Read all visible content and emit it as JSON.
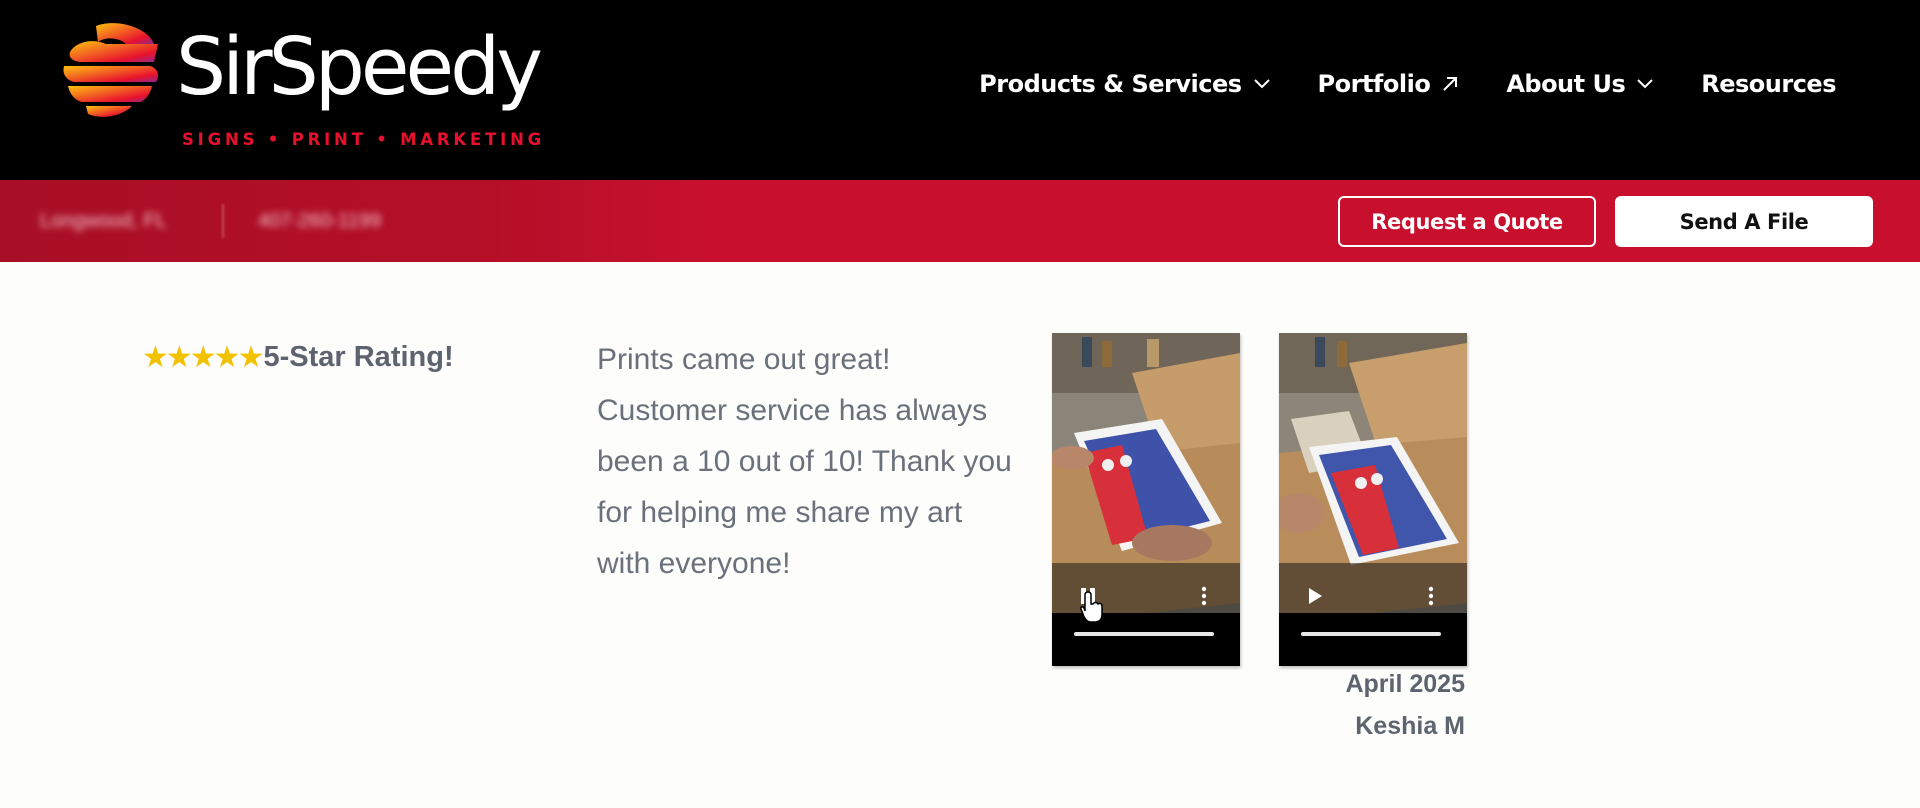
{
  "brand": {
    "name": "SirSpeedy",
    "tagline": "SIGNS • PRINT • MARKETING",
    "colors": {
      "red": "#c8102e",
      "header_bg": "#000000",
      "text_gray": "#5d6470"
    }
  },
  "nav": {
    "items": [
      {
        "label": "Products & Services",
        "icon": "chevron-down-icon"
      },
      {
        "label": "Portfolio",
        "icon": "external-arrow-icon"
      },
      {
        "label": "About Us",
        "icon": "chevron-down-icon"
      },
      {
        "label": "Resources"
      }
    ]
  },
  "utility_bar": {
    "location": "Longwood, FL",
    "phone": "407-260-1199",
    "request_quote_label": "Request a Quote",
    "send_file_label": "Send A File"
  },
  "review": {
    "stars": "★★★★★",
    "rating_label": "5-Star Rating!",
    "quote": "Prints came out great! Customer service has always been a 10 out of 10! Thank you for helping me share my art with everyone!",
    "date": "April 2025",
    "author": "Keshia M",
    "videos": [
      {
        "state": "playing",
        "control_icon": "pause-icon"
      },
      {
        "state": "paused",
        "control_icon": "play-icon"
      }
    ]
  }
}
